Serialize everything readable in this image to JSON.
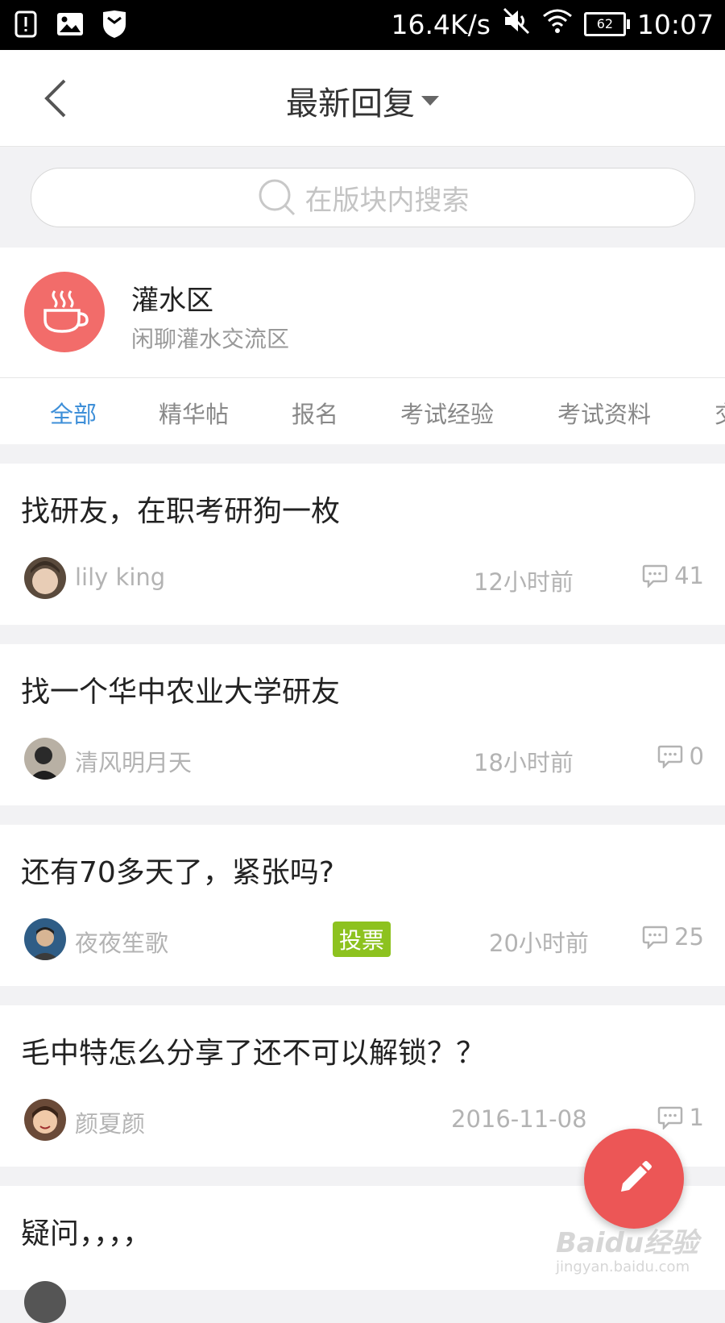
{
  "status_bar": {
    "speed": "16.4K/s",
    "battery": "62",
    "time": "10:07"
  },
  "nav": {
    "title": "最新回复"
  },
  "search": {
    "placeholder": "在版块内搜索"
  },
  "forum": {
    "name": "灌水区",
    "description": "闲聊灌水交流区",
    "logo_color": "#f26c6a"
  },
  "tabs": [
    {
      "label": "全部",
      "active": true
    },
    {
      "label": "精华帖"
    },
    {
      "label": "报名"
    },
    {
      "label": "考试经验"
    },
    {
      "label": "考试资料"
    },
    {
      "label": "交"
    }
  ],
  "posts": [
    {
      "title": "找研友，在职考研狗一枚",
      "author": "lily king",
      "time": "12小时前",
      "comments": "41"
    },
    {
      "title": "找一个华中农业大学研友",
      "author": "清风明月天",
      "time": "18小时前",
      "comments": "0"
    },
    {
      "title": "还有70多天了，紧张吗?",
      "author": "夜夜笙歌",
      "badge": "投票",
      "time": "20小时前",
      "comments": "25"
    },
    {
      "title": "毛中特怎么分享了还不可以解锁？？",
      "author": "颜夏颜",
      "time": "2016-11-08",
      "comments": "1"
    },
    {
      "title": "疑问，，，，",
      "author": "",
      "time": "",
      "comments": ""
    }
  ],
  "watermark": {
    "main": "Baidu经验",
    "sub": "jingyan.baidu.com"
  },
  "colors": {
    "accent": "#3e8fd8",
    "fab": "#ec5656",
    "badge": "#8dc21f"
  }
}
